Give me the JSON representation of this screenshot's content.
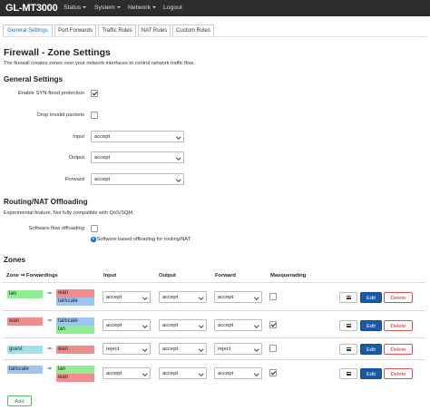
{
  "navbar": {
    "brand": "GL-MT3000",
    "items": [
      "Status",
      "System",
      "Network",
      "Logout"
    ]
  },
  "tabs": [
    "General Settings",
    "Port Forwards",
    "Traffic Rules",
    "NAT Rules",
    "Custom Rules"
  ],
  "active_tab": "General Settings",
  "page": {
    "title": "Firewall - Zone Settings",
    "description": "The firewall creates zones over your network interfaces to control network traffic flow."
  },
  "general": {
    "heading": "General Settings",
    "syn_flood_label": "Enable SYN-flood protection",
    "syn_flood_checked": true,
    "drop_invalid_label": "Drop invalid packets",
    "drop_invalid_checked": false,
    "input_label": "Input",
    "input_value": "accept",
    "output_label": "Output",
    "output_value": "accept",
    "forward_label": "Forward",
    "forward_value": "accept"
  },
  "offloading": {
    "heading": "Routing/NAT Offloading",
    "description": "Experimental feature. Not fully compatible with QoS/SQM.",
    "sw_label": "Software flow offloading",
    "sw_checked": false,
    "sw_help": "Software based offloading for routing/NAT"
  },
  "zones": {
    "heading": "Zones",
    "columns": {
      "zone": "Zone ⇒ Forwardings",
      "input": "Input",
      "output": "Output",
      "forward": "Forward",
      "masq": "Masquerading"
    },
    "rows": [
      {
        "zone": "lan",
        "zone_color": "#90ee90",
        "forwardings": [
          "wan",
          "tailscale"
        ],
        "forward_colors": [
          "#f08c8c",
          "#a0c4f2"
        ],
        "input": "accept",
        "output": "accept",
        "forward": "accept",
        "masquerading": false
      },
      {
        "zone": "wan",
        "zone_color": "#f08c8c",
        "forwardings": [
          "tailscale",
          "lan"
        ],
        "forward_colors": [
          "#a0c4f2",
          "#90ee90"
        ],
        "input": "accept",
        "output": "accept",
        "forward": "accept",
        "masquerading": true
      },
      {
        "zone": "guest",
        "zone_color": "#9fe3ea",
        "forwardings": [
          "wan"
        ],
        "forward_colors": [
          "#f08c8c"
        ],
        "input": "reject",
        "output": "accept",
        "forward": "reject",
        "masquerading": false
      },
      {
        "zone": "tailscale",
        "zone_color": "#a0c4f2",
        "forwardings": [
          "lan",
          "wan"
        ],
        "forward_colors": [
          "#90ee90",
          "#f08c8c"
        ],
        "input": "accept",
        "output": "accept",
        "forward": "accept",
        "masquerading": true
      }
    ],
    "arrow": "⇒",
    "edit_label": "Edit",
    "delete_label": "Delete",
    "add_label": "Add"
  },
  "colors": {
    "navbar_bg": "#2d2d2d",
    "edit_button": "#1a58a8",
    "delete_border": "#d9534f",
    "add_border": "#5cb85c",
    "active_tab_text": "#1a6fc4"
  }
}
